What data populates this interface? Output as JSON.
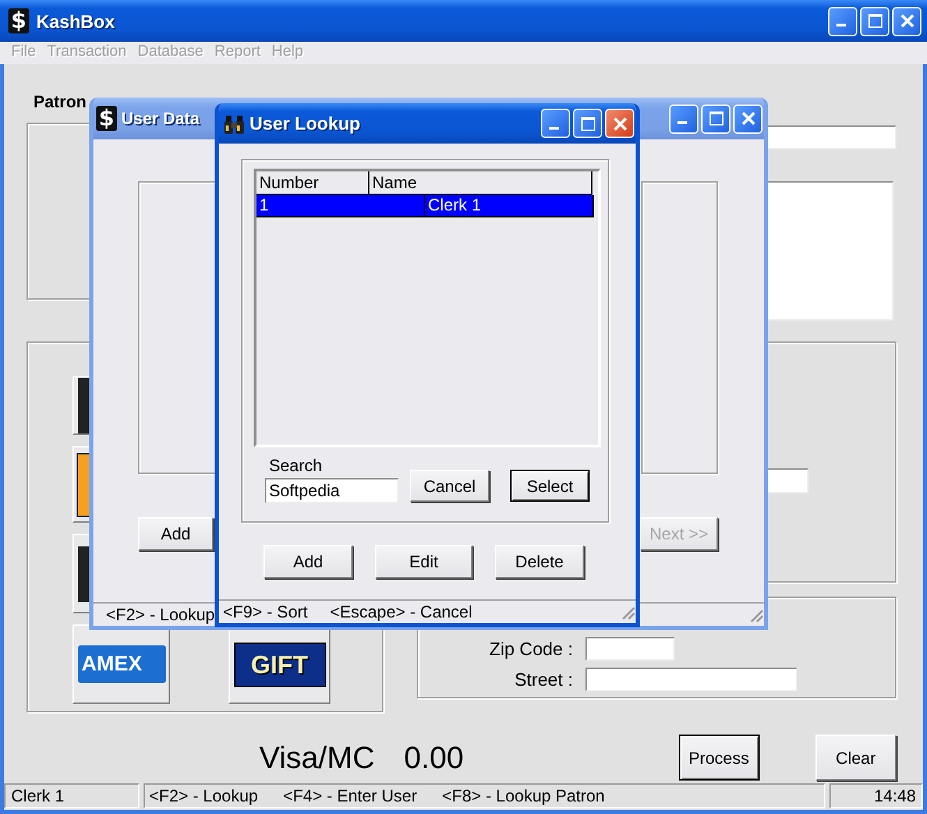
{
  "window": {
    "icon": "$",
    "title": "KashBox"
  },
  "menu": [
    "File",
    "Transaction",
    "Database",
    "Report",
    "Help"
  ],
  "patron": {
    "label": "Patron"
  },
  "payment_buttons": [
    {
      "kind": "dark"
    },
    {
      "kind": "orange"
    },
    {
      "kind": "dark"
    },
    {
      "kind": "amex",
      "label": "AMEX"
    },
    {
      "kind": "gift",
      "label": "GIFT"
    }
  ],
  "address_fields": [
    {
      "label": "Zip Code :"
    },
    {
      "label": "Street :"
    }
  ],
  "total": {
    "label": "Visa/MC",
    "amount": "0.00"
  },
  "buttons": [
    {
      "label": "Process",
      "default": true
    },
    {
      "label": "Clear",
      "default": false
    }
  ],
  "status_bar": {
    "user": "Clerk 1",
    "hints": [
      "<F2> - Lookup",
      "<F4> - Enter User",
      "<F8> - Lookup Patron"
    ],
    "clock": "14:48"
  },
  "user_database_dialog": {
    "icon": "$",
    "title": "User Data",
    "buttons": [
      {
        "label": "Add",
        "disabled": false
      },
      {
        "label": "Next >>",
        "disabled": true
      }
    ],
    "status": "<F2> - Lookup"
  },
  "user_lookup_dialog": {
    "title": "User Lookup",
    "columns": [
      "Number",
      "Name"
    ],
    "rows": [
      {
        "cells": [
          "1",
          "Clerk 1"
        ],
        "selected": true
      }
    ],
    "search": {
      "label": "Search",
      "value": "Softpedia"
    },
    "search_buttons": [
      {
        "label": "Cancel",
        "default": false
      },
      {
        "label": "Select",
        "default": true
      }
    ],
    "buttons": [
      "Add",
      "Edit",
      "Delete"
    ],
    "status": [
      "<F9> - Sort",
      "<Escape> - Cancel"
    ]
  }
}
